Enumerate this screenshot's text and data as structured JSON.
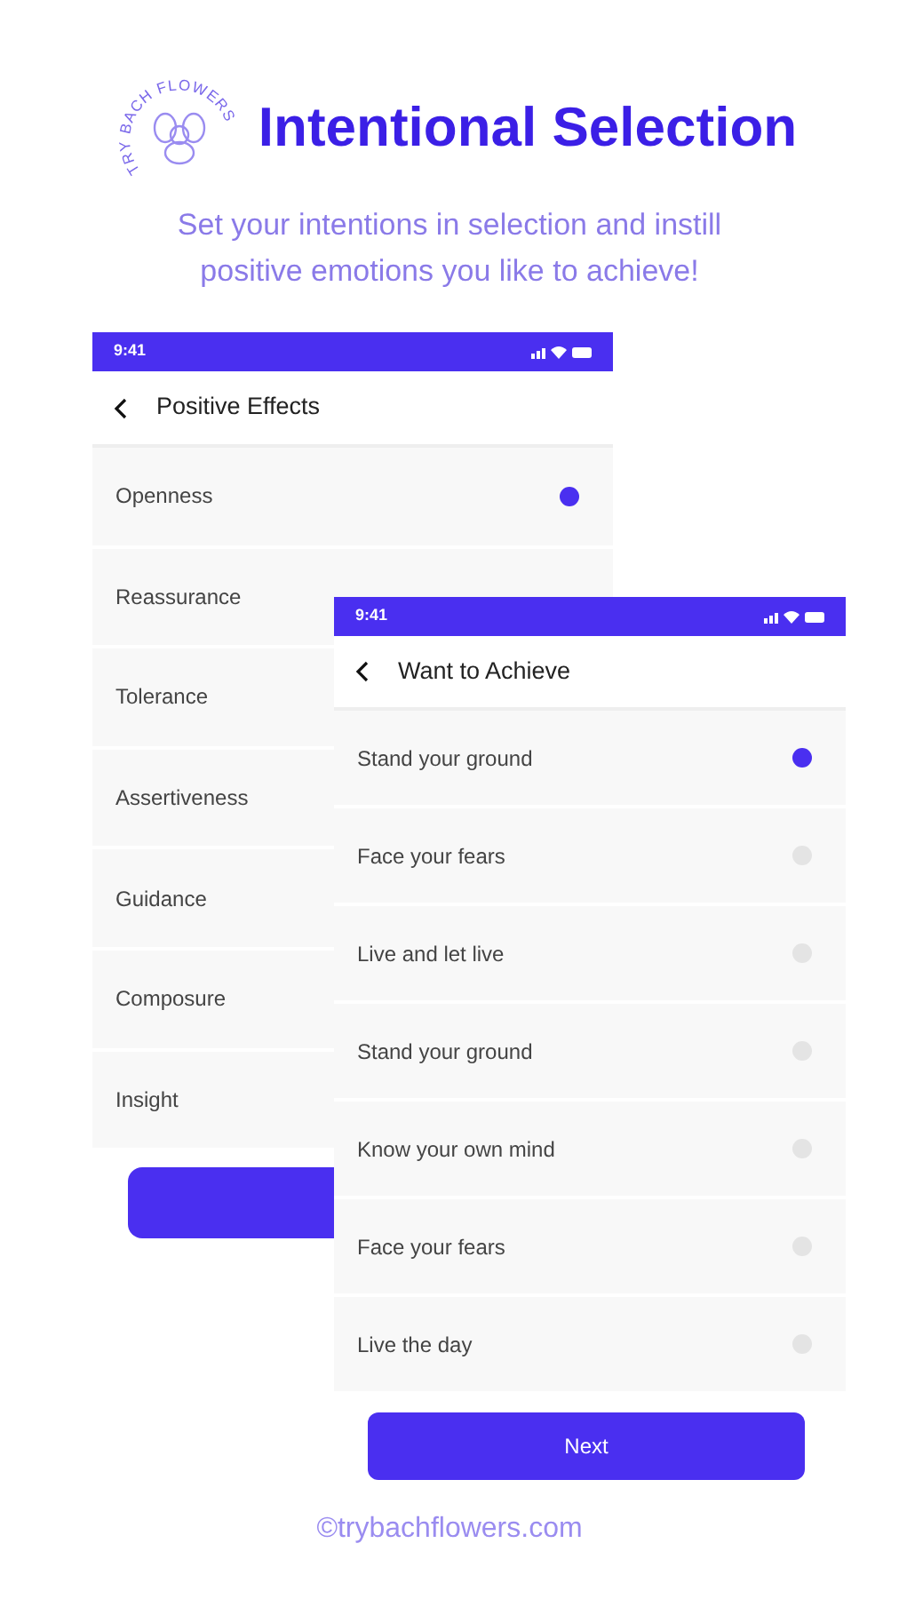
{
  "logo": {
    "text": "TRY BACH FLOWERS"
  },
  "title": "Intentional Selection",
  "subtitle": "Set your intentions in selection and instill positive emotions you like to achieve!",
  "screens": [
    {
      "status_time": "9:41",
      "title": "Positive Effects",
      "items": [
        {
          "label": "Openness",
          "selected": true
        },
        {
          "label": "Reassurance"
        },
        {
          "label": "Tolerance"
        },
        {
          "label": "Assertiveness"
        },
        {
          "label": "Guidance"
        },
        {
          "label": "Composure"
        },
        {
          "label": "Insight"
        }
      ]
    },
    {
      "status_time": "9:41",
      "title": "Want to Achieve",
      "items": [
        {
          "label": "Stand your ground",
          "selected": true
        },
        {
          "label": "Face your fears",
          "selected": false
        },
        {
          "label": "Live and let live",
          "selected": false
        },
        {
          "label": "Stand your ground",
          "selected": false
        },
        {
          "label": "Know your own mind",
          "selected": false
        },
        {
          "label": "Face your fears",
          "selected": false
        },
        {
          "label": "Live the day",
          "selected": false
        }
      ],
      "button": "Next"
    }
  ],
  "footer": "©trybachflowers.com"
}
